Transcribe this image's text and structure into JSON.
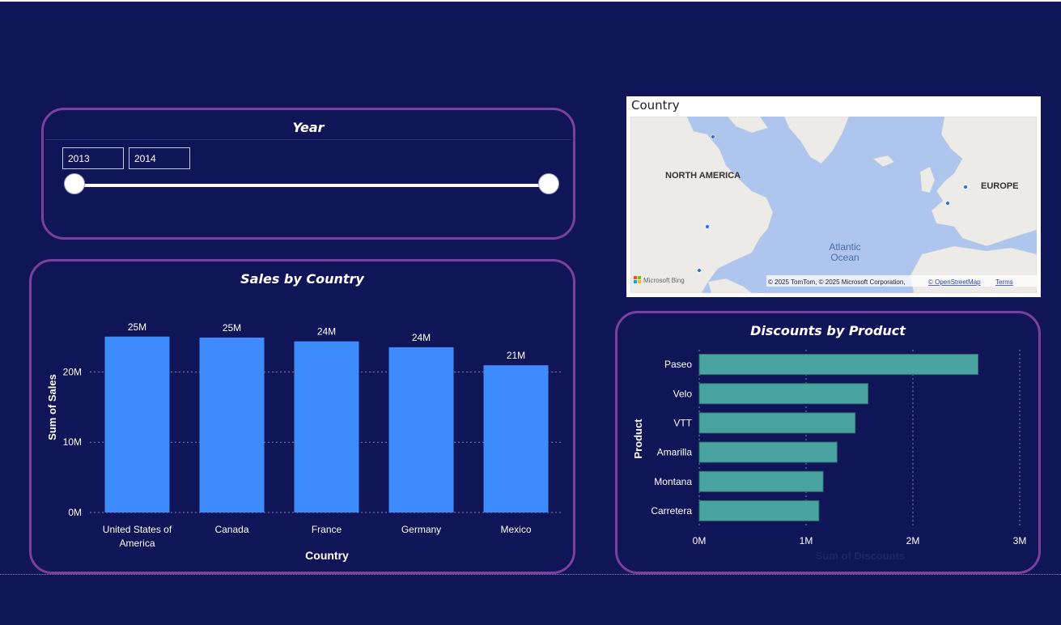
{
  "year_slicer": {
    "title": "Year",
    "start_value": "2013",
    "end_value": "2014"
  },
  "sales_chart": {
    "title": "Sales by Country"
  },
  "map": {
    "title": "Country",
    "labels": {
      "north_america": "NORTH AMERICA",
      "europe": "EUROPE",
      "ocean_line1": "Atlantic",
      "ocean_line2": "Ocean"
    },
    "logo": "Microsoft Bing",
    "attribution": "© 2025 TomTom, © 2025 Microsoft Corporation,",
    "osm_link": "© OpenStreetMap",
    "terms_link": "Terms"
  },
  "discounts_chart": {
    "title": "Discounts by Product"
  },
  "colors": {
    "background": "#0f1556",
    "card_border": "#7b3fa0",
    "sales_bar": "#3d8bfd",
    "discount_bar": "#48a3a1"
  },
  "chart_data": [
    {
      "type": "bar",
      "title": "Sales by Country",
      "xlabel": "Country",
      "ylabel": "Sum of Sales",
      "categories": [
        "United States of America",
        "Canada",
        "France",
        "Germany",
        "Mexico"
      ],
      "values": [
        25030000,
        24890000,
        24350000,
        23510000,
        20950000
      ],
      "data_labels": [
        "25M",
        "25M",
        "24M",
        "24M",
        "21M"
      ],
      "yticks": [
        0,
        10000000,
        20000000
      ],
      "ytick_labels": [
        "0M",
        "10M",
        "20M"
      ],
      "ylim": [
        0,
        26500000
      ],
      "grid": true
    },
    {
      "type": "bar",
      "orientation": "horizontal",
      "title": "Discounts by Product",
      "xlabel": "Sum of Discounts",
      "ylabel": "Product",
      "categories": [
        "Paseo",
        "Velo",
        "VTT",
        "Amarilla",
        "Montana",
        "Carretera"
      ],
      "values": [
        2610000,
        1580000,
        1460000,
        1290000,
        1160000,
        1120000
      ],
      "xticks": [
        0,
        1000000,
        2000000,
        3000000
      ],
      "xtick_labels": [
        "0M",
        "1M",
        "2M",
        "3M"
      ],
      "xlim": [
        0,
        3000000
      ],
      "grid": true
    }
  ]
}
